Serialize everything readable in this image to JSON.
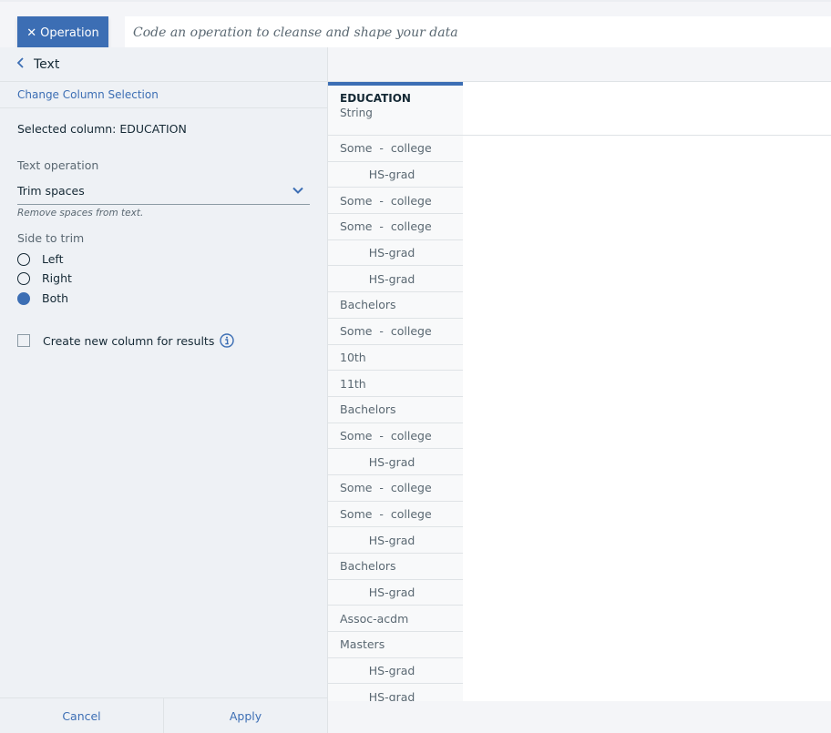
{
  "topbar": {
    "operation_button_label": "Operation",
    "code_input_placeholder": "Code an operation to cleanse and shape your data",
    "code_input_value": ""
  },
  "panel": {
    "back_title": "Text",
    "change_column_link": "Change Column Selection",
    "selected_column_text": "Selected column: EDUCATION",
    "text_operation_label": "Text operation",
    "text_operation_value": "Trim spaces",
    "text_operation_helper": "Remove spaces from text.",
    "side_label": "Side to trim",
    "side_options": [
      {
        "label": "Left",
        "checked": false
      },
      {
        "label": "Right",
        "checked": false
      },
      {
        "label": "Both",
        "checked": true
      }
    ],
    "new_column_label": "Create new column for results",
    "new_column_checked": false
  },
  "footer": {
    "cancel_label": "Cancel",
    "apply_label": "Apply"
  },
  "grid": {
    "column_name": "EDUCATION",
    "column_type": "String",
    "cells": [
      "Some  -  college",
      "        HS-grad",
      "Some  -  college",
      "Some  -  college",
      "        HS-grad",
      "        HS-grad",
      "Bachelors",
      "Some  -  college",
      "10th",
      "11th",
      "Bachelors",
      "Some  -  college",
      "        HS-grad",
      "Some  -  college",
      "Some  -  college",
      "        HS-grad",
      "Bachelors",
      "        HS-grad",
      "Assoc-acdm",
      "Masters",
      "        HS-grad",
      "        HS-grad"
    ]
  },
  "colors": {
    "accent": "#3c6eb4"
  }
}
